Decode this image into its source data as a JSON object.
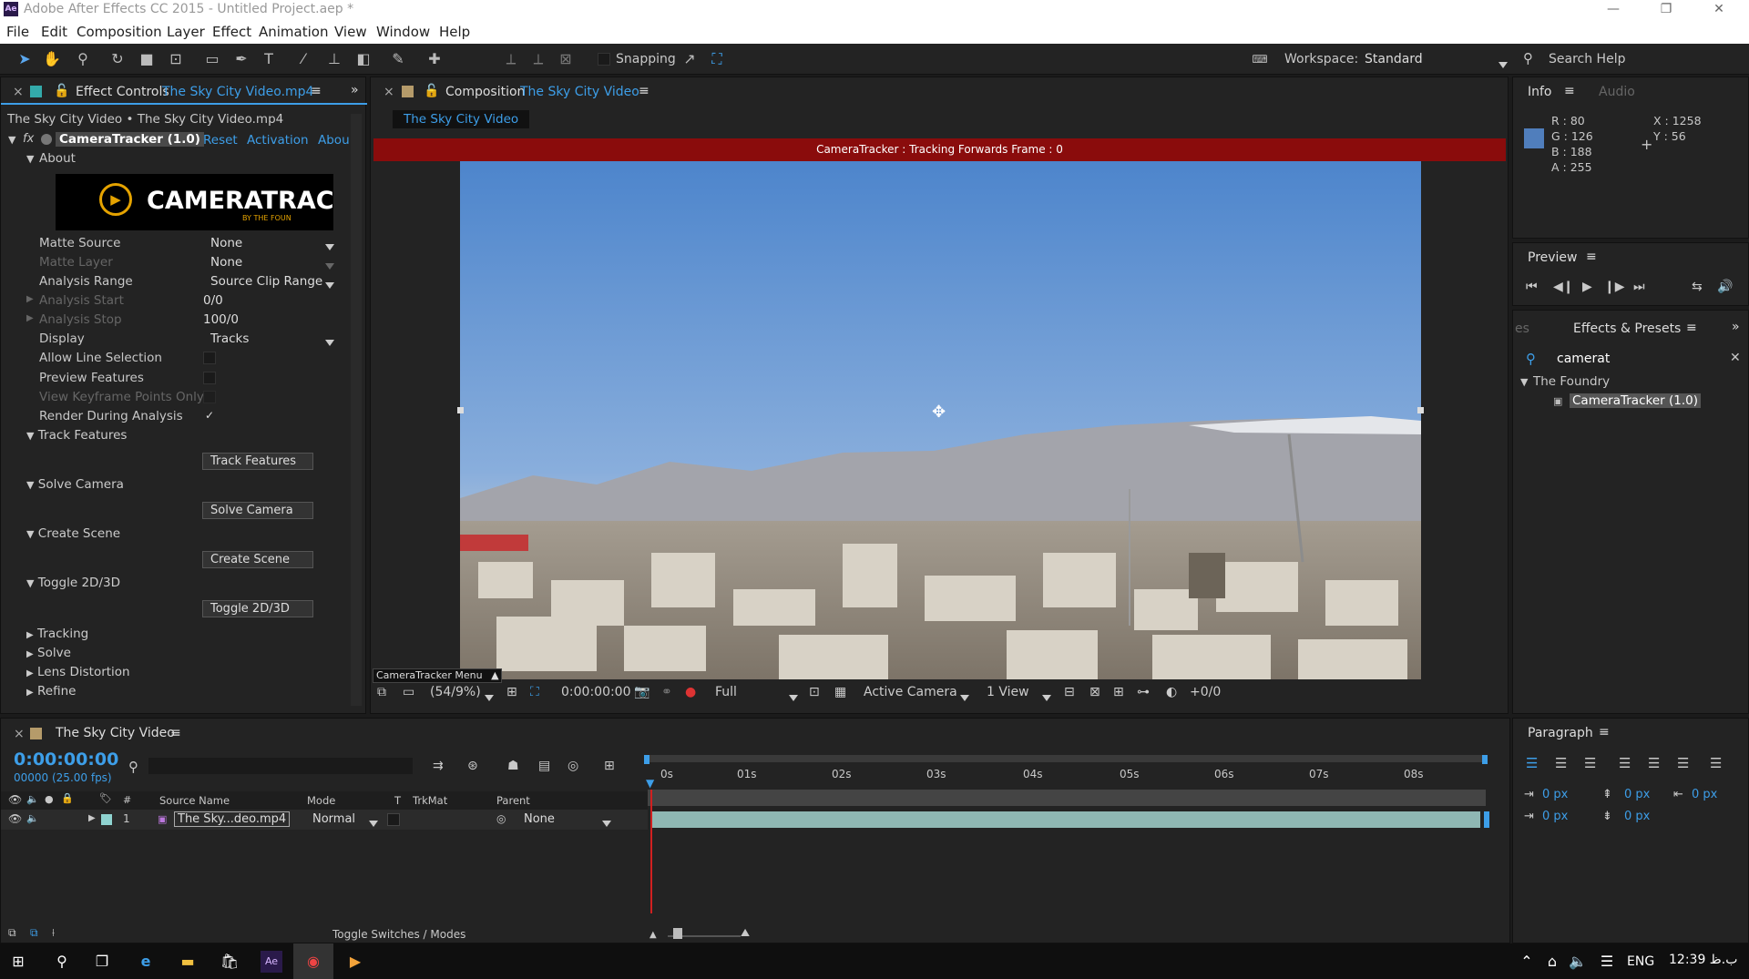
{
  "window": {
    "title": "Adobe After Effects CC 2015 - Untitled Project.aep *",
    "app_icon": "Ae",
    "controls": [
      "minimize-icon",
      "restore-icon",
      "close-icon"
    ]
  },
  "menu": [
    "File",
    "Edit",
    "Composition",
    "Layer",
    "Effect",
    "Animation",
    "View",
    "Window",
    "Help"
  ],
  "toolbar": {
    "snapping_label": "Snapping",
    "workspace_label": "Workspace:",
    "workspace_value": "Standard",
    "search_help": "Search Help"
  },
  "effect_controls": {
    "tab_label": "Effect Controls",
    "tab_file": "The Sky City Video.mp4",
    "breadcrumb": "The Sky City Video • The Sky City Video.mp4",
    "fx_label": "fx",
    "effect_name": "CameraTracker (1.0)",
    "reset": "Reset",
    "activation": "Activation",
    "about_link": "Abou",
    "about_section": "About",
    "logo_text": "CAMERATRACKE",
    "logo_sub": "BY THE FOUN",
    "props": [
      {
        "label": "Matte Source",
        "value": "None",
        "enabled": true,
        "dropdown": true
      },
      {
        "label": "Matte Layer",
        "value": "None",
        "enabled": false,
        "dropdown": true
      },
      {
        "label": "Analysis Range",
        "value": "Source Clip Range",
        "enabled": true,
        "dropdown": true
      },
      {
        "label": "Analysis Start",
        "value": "0/0",
        "enabled": false,
        "dropdown": false
      },
      {
        "label": "Analysis Stop",
        "value": "100/0",
        "enabled": false,
        "dropdown": false
      },
      {
        "label": "Display",
        "value": "Tracks",
        "enabled": true,
        "dropdown": true
      }
    ],
    "checks": [
      {
        "label": "Allow Line Selection",
        "checked": false,
        "enabled": true
      },
      {
        "label": "Preview Features",
        "checked": false,
        "enabled": true
      },
      {
        "label": "View Keyframe Points Only",
        "checked": false,
        "enabled": false
      },
      {
        "label": "Render During Analysis",
        "checked": true,
        "enabled": true
      }
    ],
    "check_mark": "✓",
    "sections": [
      {
        "title": "Track Features",
        "button": "Track Features"
      },
      {
        "title": "Solve Camera",
        "button": "Solve Camera"
      },
      {
        "title": "Create Scene",
        "button": "Create Scene"
      },
      {
        "title": "Toggle 2D/3D",
        "button": "Toggle 2D/3D"
      }
    ],
    "collapsed": [
      "Tracking",
      "Solve",
      "Lens Distortion",
      "Refine"
    ]
  },
  "composition": {
    "tab_label": "Composition",
    "tab_name": "The Sky City Video",
    "sub_tab": "The Sky City Video",
    "banner": "CameraTracker : Tracking Forwards Frame : 0",
    "menu_label": "CameraTracker Menu",
    "zoom": "(54/9%)",
    "timecode": "0:00:00:00",
    "resolution": "Full",
    "camera": "Active Camera",
    "views": "1 View",
    "exposure": "+0/0"
  },
  "info": {
    "tab": "Info",
    "tab2": "Audio",
    "r": "R : 80",
    "g": "G : 126",
    "b": "B : 188",
    "a": "A : 255",
    "x": "X : 1258",
    "y": "Y : 56",
    "swatch": "#507EBC"
  },
  "preview": {
    "title": "Preview"
  },
  "effects_presets": {
    "title": "Effects & Presets",
    "left_tab": "es",
    "search": "camerat",
    "folder": "The Foundry",
    "item": "CameraTracker (1.0)"
  },
  "timeline": {
    "comp_name": "The Sky City Video",
    "timecode": "0:00:00:00",
    "frames": "00000 (25.00 fps)",
    "headers": {
      "source": "Source Name",
      "mode": "Mode",
      "t": "T",
      "trkmat": "TrkMat",
      "parent": "Parent",
      "num": "#"
    },
    "layer": {
      "num": "1",
      "name": "The Sky...deo.mp4",
      "mode": "Normal",
      "parent": "None"
    },
    "ruler": [
      "0s",
      "01s",
      "02s",
      "03s",
      "04s",
      "05s",
      "06s",
      "07s",
      "08s"
    ],
    "toggle": "Toggle Switches / Modes"
  },
  "paragraph": {
    "title": "Paragraph",
    "values": [
      "0 px",
      "0 px",
      "0 px",
      "0 px",
      "0 px"
    ]
  },
  "taskbar": {
    "lang": "ENG",
    "clock": "12:39 ب.ظ"
  }
}
